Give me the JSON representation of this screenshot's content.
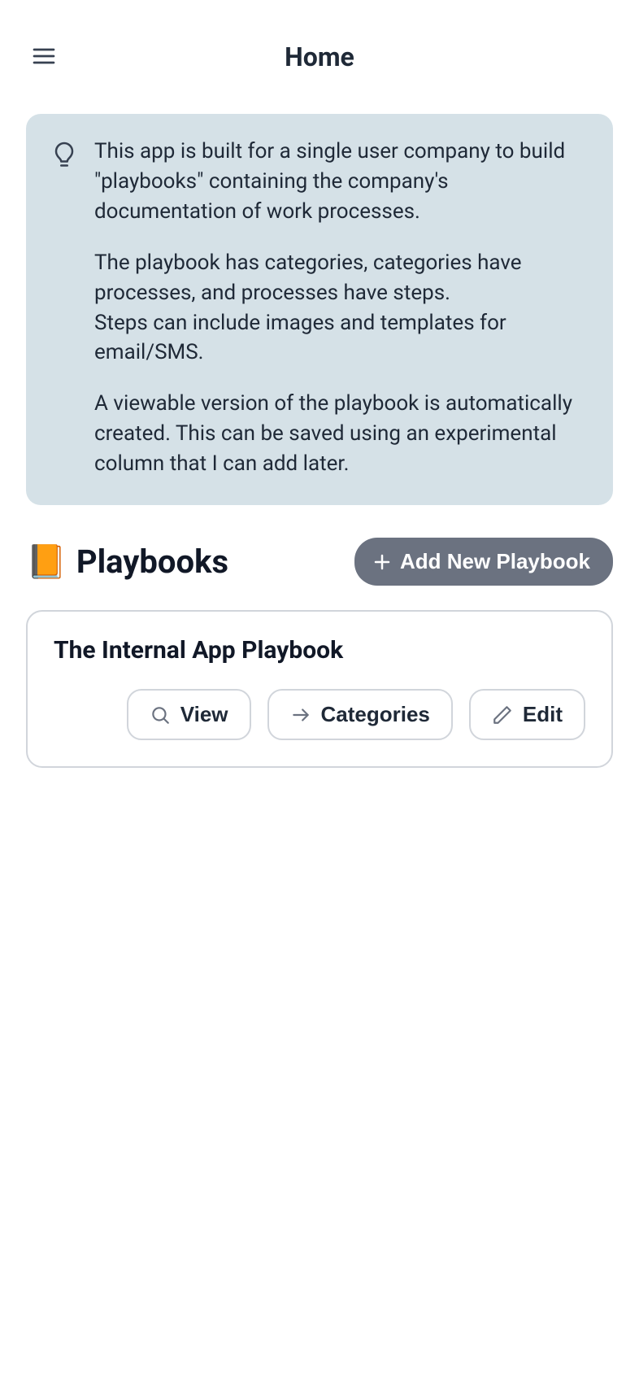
{
  "header": {
    "title": "Home"
  },
  "info": {
    "p1": "This app is built for a single user company to build \"playbooks\" containing the company's documentation of work processes.",
    "p2": "The playbook has categories, categories have processes, and processes have steps.",
    "p3": "Steps can include images and templates for email/SMS.",
    "p4": "A viewable version of the playbook is automatically created. This can be saved using an experimental column that I can add later."
  },
  "section": {
    "emoji": "📙",
    "title": "Playbooks",
    "add_label": "Add New Playbook"
  },
  "playbooks": [
    {
      "title": "The Internal App Playbook",
      "view_label": "View",
      "categories_label": "Categories",
      "edit_label": "Edit"
    }
  ]
}
